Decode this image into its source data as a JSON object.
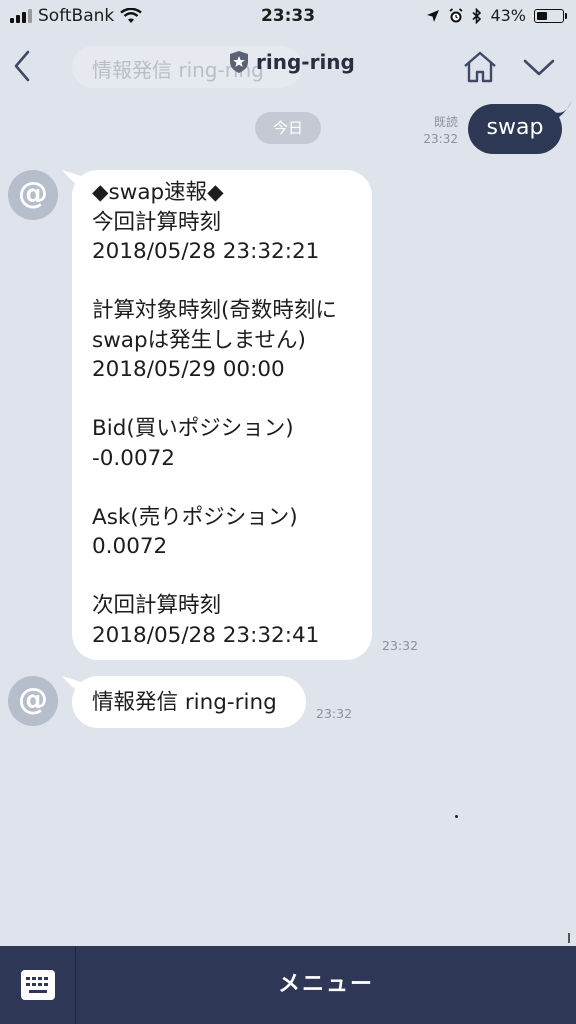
{
  "status_bar": {
    "carrier": "SoftBank",
    "time": "23:33",
    "battery": "43%",
    "battery_level": 0.43
  },
  "header": {
    "title": "ring-ring",
    "ghost_text": "情報発信 ring-ring"
  },
  "chat": {
    "date_separator": "今日",
    "sent": {
      "text": "swap",
      "read_label": "既読",
      "time": "23:32"
    },
    "received": [
      {
        "text": "◆swap速報◆\n今回計算時刻\n2018/05/28 23:32:21\n\n計算対象時刻(奇数時刻に\nswapは発生しません)\n2018/05/29 00:00\n\nBid(買いポジション)\n-0.0072\n\nAsk(売りポジション)\n0.0072\n\n次回計算時刻\n2018/05/28 23:32:41",
        "time": "23:32"
      },
      {
        "text": "情報発信 ring-ring",
        "time": "23:32"
      }
    ]
  },
  "bottom_bar": {
    "menu_label": "メニュー",
    "keyboard_icon": "keyboard-icon"
  },
  "colors": {
    "background": "#dfe3ec",
    "sent_bubble": "#2d3855",
    "bottom_bar": "#2e3856",
    "avatar": "#b6bdcb"
  }
}
